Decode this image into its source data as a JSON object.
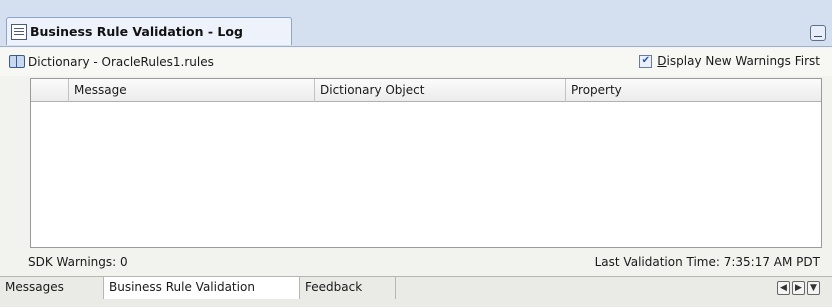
{
  "window": {
    "title": "Business Rule Validation - Log"
  },
  "header": {
    "dictionary_label": "Dictionary - OracleRules1.rules",
    "checkbox_label_prefix": "",
    "checkbox_label_underlined": "D",
    "checkbox_label_rest": "isplay New Warnings First",
    "checkbox_checked": true
  },
  "table": {
    "columns": [
      "Message",
      "Dictionary Object",
      "Property"
    ],
    "rows": []
  },
  "status": {
    "sdk_warnings": "SDK Warnings: 0",
    "last_validation": "Last Validation Time: 7:35:17 AM PDT"
  },
  "bottom_tabs": {
    "items": [
      "Messages",
      "Business Rule Validation",
      "Feedback"
    ],
    "active": "Business Rule Validation"
  },
  "icons": {
    "title": "document-icon",
    "dictionary": "book-icon",
    "minimize": "minimize-icon",
    "nav_prev": "arrow-left-icon",
    "nav_next": "arrow-right-icon",
    "nav_menu": "dropdown-icon"
  }
}
